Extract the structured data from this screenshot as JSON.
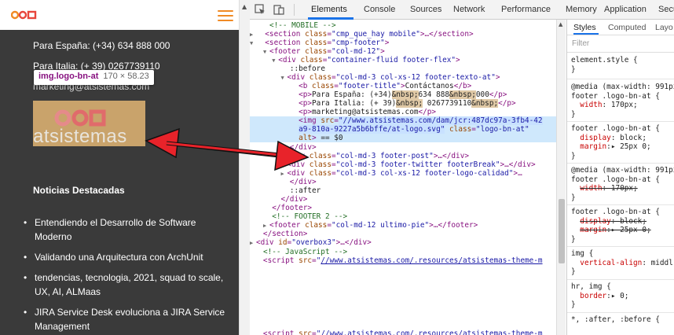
{
  "preview": {
    "phone_text": "Para España: (+34) 634 888 000",
    "italy_text": "Para Italia: (+ 39)  0267739110",
    "email_text": "marketing@atsistemas.com",
    "tooltip_selector": "img.logo-bn-at",
    "tooltip_size": "170 × 58.23",
    "logo_text": "atsistemas",
    "section_title": "Noticias Destacadas",
    "news": [
      "Entendiendo el Desarrollo de Software Moderno",
      "Validando una Arquitectura con ArchUnit",
      "tendencias, tecnologia, 2021, squad to scale, UX, AI, ALMaas",
      "JIRA Service Desk evoluciona a JIRA Service Management"
    ],
    "colors": {
      "accent": "#f08a24",
      "background": "#3a3a3a",
      "highlight": "#c9a36b"
    }
  },
  "devtools": {
    "tabs": [
      "Elements",
      "Console",
      "Sources",
      "Network",
      "Performance",
      "Memory",
      "Application",
      "Security"
    ],
    "active_tab": "Elements",
    "styles_tabs": [
      "Styles",
      "Computed",
      "Layo"
    ],
    "filter_placeholder": "Filter",
    "selected_src_1": "//www.atsistemas.com/dam/jcr:487dc97a-3fb4-42",
    "selected_src_2": "a9-810a-9227a5b6bffe/at-logo.svg",
    "selected_class": "logo-bn-at",
    "styles": {
      "element_style": "element.style {",
      "media1": "@media (max-width: 991px",
      "selector": "footer .logo-bn-at {",
      "width": "170px;",
      "display": "block;",
      "margin": "▸ 25px 0;",
      "img_rule": "img {",
      "vertical_align": "middl",
      "hr_img": "hr, img {",
      "border": "▸ 0;",
      "after_before": "*, :after, :before {"
    }
  }
}
